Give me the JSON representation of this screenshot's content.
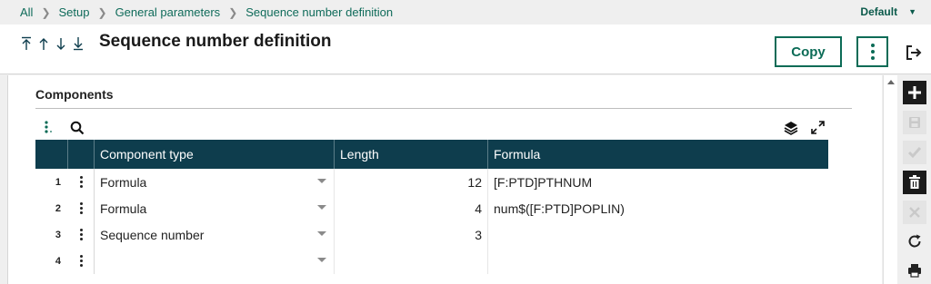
{
  "breadcrumb": [
    "All",
    "Setup",
    "General parameters",
    "Sequence number definition"
  ],
  "view_selector": {
    "label": "Default"
  },
  "page": {
    "title": "Sequence number definition"
  },
  "toolbar": {
    "copy_label": "Copy"
  },
  "section": {
    "title": "Components"
  },
  "grid": {
    "columns": [
      "Component type",
      "Length",
      "Formula"
    ],
    "rows": [
      {
        "num": "1",
        "type": "Formula",
        "length": "12",
        "formula": "[F:PTD]PTHNUM"
      },
      {
        "num": "2",
        "type": "Formula",
        "length": "4",
        "formula": "num$([F:PTD]POPLIN)"
      },
      {
        "num": "3",
        "type": "Sequence number",
        "length": "3",
        "formula": ""
      },
      {
        "num": "4",
        "type": "",
        "length": "",
        "formula": ""
      }
    ]
  },
  "icons": {
    "nav": [
      "first-record-icon",
      "previous-record-icon",
      "next-record-icon",
      "last-record-icon"
    ],
    "actions": [
      "add-icon",
      "save-icon",
      "validate-icon",
      "delete-icon",
      "cancel-icon",
      "refresh-icon",
      "print-icon"
    ]
  },
  "colors": {
    "accent": "#0b6b56",
    "grid_header": "#0e3d4d",
    "link": "#0f6b5a"
  }
}
